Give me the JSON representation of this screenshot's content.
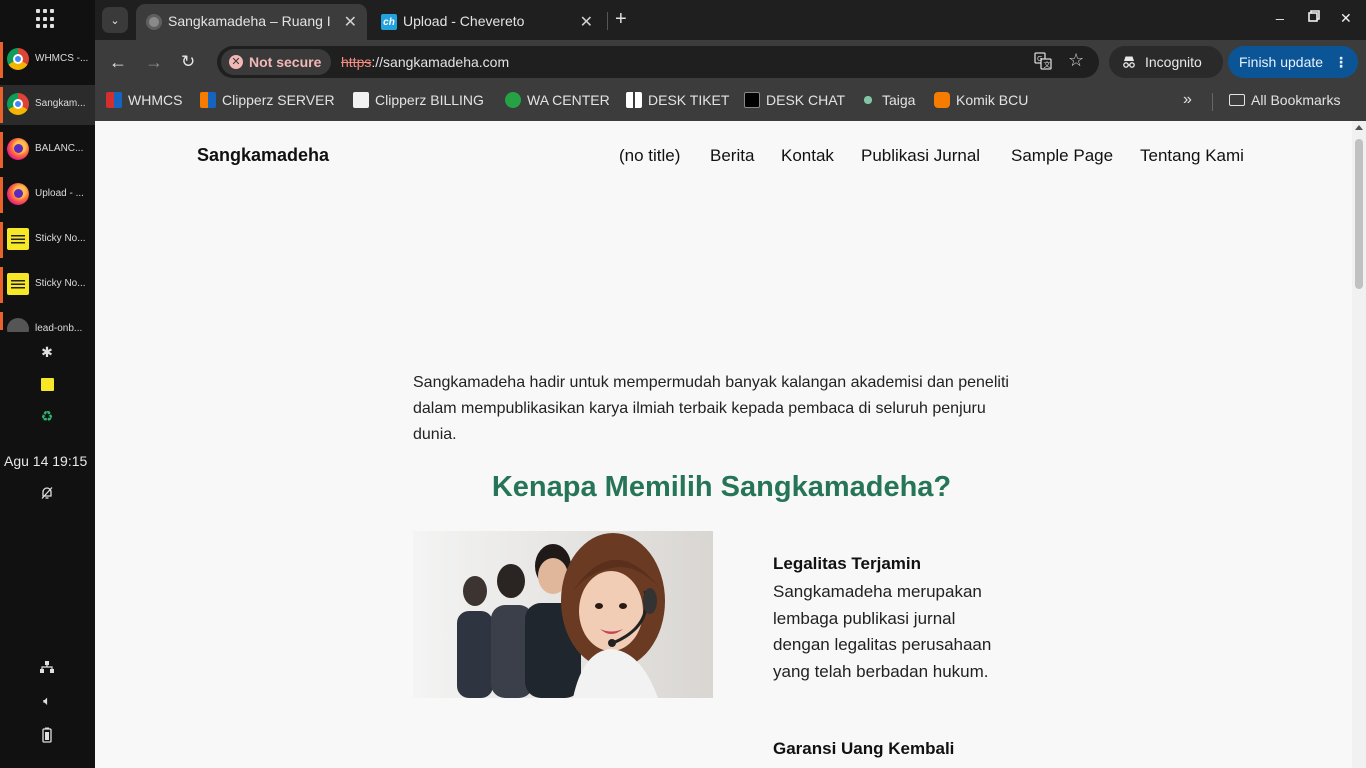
{
  "taskbar": {
    "items": [
      {
        "label": "WHMCS -...",
        "icon": "chrome-icon"
      },
      {
        "label": "Sangkam...",
        "icon": "chrome-icon"
      },
      {
        "label": "BALANC...",
        "icon": "firefox-icon"
      },
      {
        "label": "Upload - ...",
        "icon": "firefox-icon"
      },
      {
        "label": "Sticky No...",
        "icon": "sticky-notes-icon"
      },
      {
        "label": "Sticky No...",
        "icon": "sticky-notes-icon"
      },
      {
        "label": "lead-onb...",
        "icon": "app-icon"
      }
    ],
    "clock": "Agu 14   19:15"
  },
  "tabs": [
    {
      "title": "Sangkamadeha – Ruang I",
      "icon": "globe-icon"
    },
    {
      "title": "Upload - Chevereto",
      "icon": "chevereto-icon"
    }
  ],
  "toolbar": {
    "security_label": "Not secure",
    "url_scheme": "https",
    "url_rest": "://sangkamadeha.com",
    "incognito_label": "Incognito",
    "finish_update_label": "Finish update"
  },
  "bookmarks": {
    "items": [
      "WHMCS",
      "Clipperz SERVER",
      "Clipperz BILLING",
      "WA CENTER",
      "DESK TIKET",
      "DESK CHAT",
      "Taiga",
      "Komik BCU"
    ],
    "all_label": "All Bookmarks"
  },
  "site": {
    "title": "Sangkamadeha",
    "nav": [
      "(no title)",
      "Berita",
      "Kontak",
      "Publikasi Jurnal",
      "Sample Page",
      "Tentang Kami"
    ],
    "intro": "Sangkamadeha hadir untuk mempermudah banyak kalangan akademisi dan peneliti dalam mempublikasikan karya ilmiah terbaik kepada pembaca di seluruh penjuru dunia.",
    "heading": "Kenapa Memilih Sangkamadeha?",
    "features": [
      {
        "title": "Legalitas Terjamin",
        "text": "Sangkamadeha merupakan lembaga publikasi jurnal dengan legalitas perusahaan yang telah berbadan hukum."
      },
      {
        "title": "Garansi Uang Kembali"
      }
    ]
  },
  "colors": {
    "heading_green": "#267558",
    "finish_update_bg": "#0b5596",
    "taskbar_accent": "#e8632b"
  }
}
